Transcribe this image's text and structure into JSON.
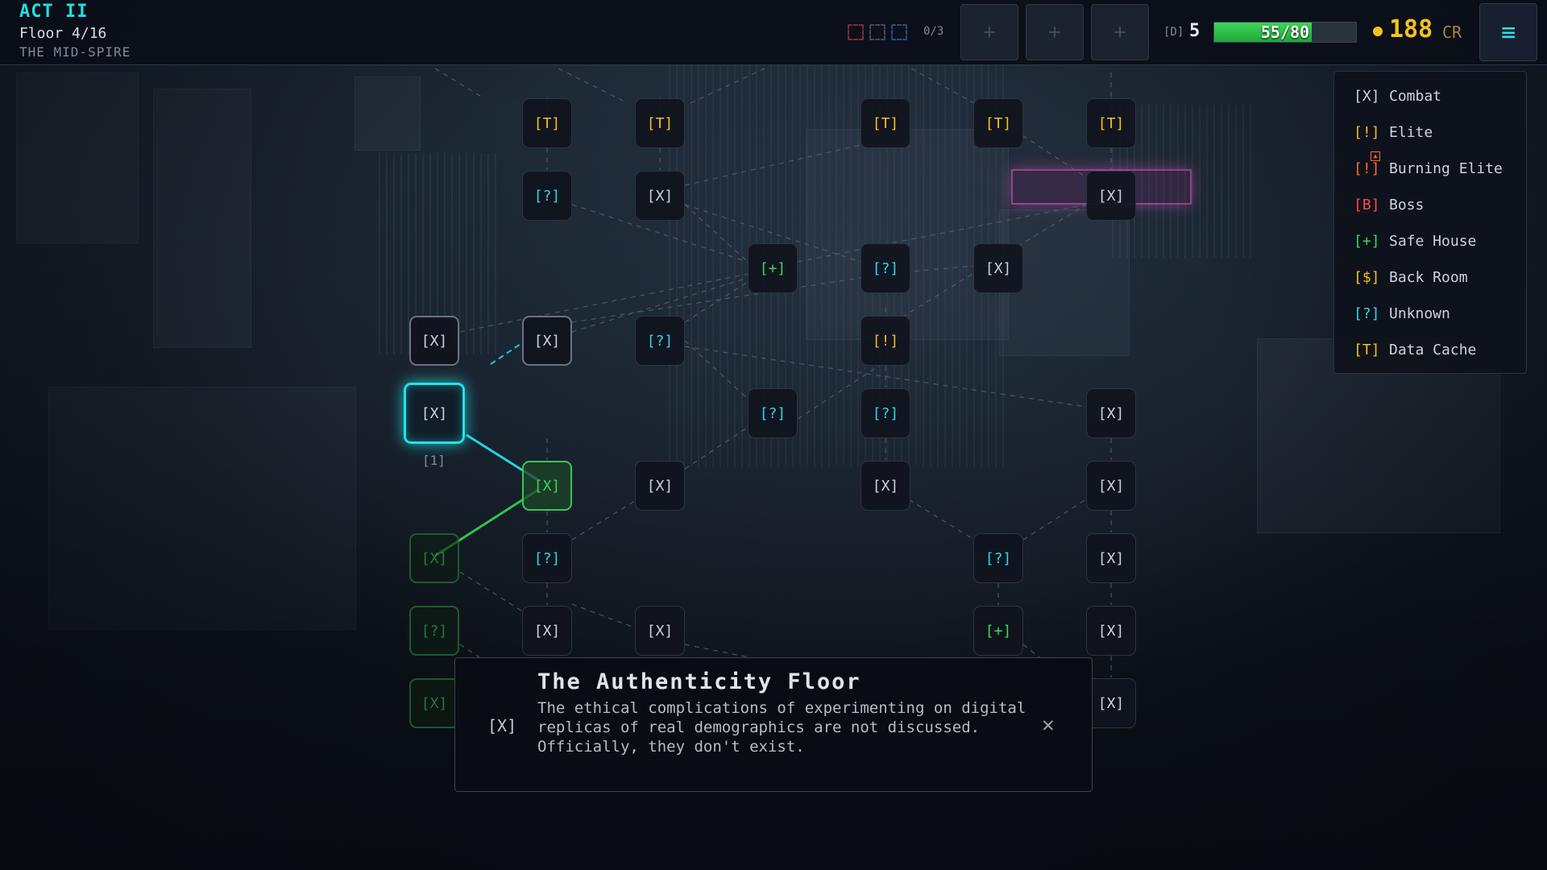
{
  "hud": {
    "act": "ACT II",
    "floor": "Floor 4/16",
    "zone": "THE MID-SPIRE",
    "consumable_slots": {
      "used_label": "0/3",
      "slot_colors": [
        "#8a2a30",
        "#3a4a6a",
        "#2a4a80"
      ]
    },
    "item_buttons": [
      "+",
      "+",
      "+"
    ],
    "deck": {
      "tag": "[D]",
      "count": "5"
    },
    "hp": {
      "text": "55/80",
      "current": 55,
      "max": 80,
      "color": "#3ed65a"
    },
    "credits": {
      "value": "188",
      "unit": "CR",
      "color": "#f5c21b"
    },
    "menu_icon": "≡"
  },
  "legend": [
    {
      "symbol": "[X]",
      "label": "Combat",
      "color": "#cdd3db"
    },
    {
      "symbol": "[!]",
      "label": "Elite",
      "color": "#f5b82e"
    },
    {
      "symbol": "[!]",
      "label": "Burning Elite",
      "color": "#ff6a2b"
    },
    {
      "symbol": "[B]",
      "label": "Boss",
      "color": "#ff4a4a"
    },
    {
      "symbol": "[+]",
      "label": "Safe House",
      "color": "#3fd45a"
    },
    {
      "symbol": "[$]",
      "label": "Back Room",
      "color": "#f5c21b"
    },
    {
      "symbol": "[?]",
      "label": "Unknown",
      "color": "#2ed8e6"
    },
    {
      "symbol": "[T]",
      "label": "Data Cache",
      "color": "#f5c21b"
    }
  ],
  "map": {
    "current_node_index": "[1]",
    "nodes": [
      {
        "id": "t1",
        "label": "[T]",
        "state": "normal",
        "color": "#f5c21b"
      },
      {
        "id": "t2",
        "label": "[T]",
        "state": "normal",
        "color": "#f5c21b"
      },
      {
        "id": "t3",
        "label": "[T]",
        "state": "normal",
        "color": "#f5c21b"
      },
      {
        "id": "t4",
        "label": "[T]",
        "state": "normal",
        "color": "#f5c21b"
      },
      {
        "id": "t5",
        "label": "[T]",
        "state": "normal",
        "color": "#f5c21b"
      },
      {
        "id": "u1",
        "label": "[?]",
        "state": "normal",
        "color": "#2ed8e6"
      },
      {
        "id": "x1",
        "label": "[X]",
        "state": "normal",
        "color": "#cdd3db"
      },
      {
        "id": "x2",
        "label": "[X]",
        "state": "normal",
        "color": "#cdd3db"
      },
      {
        "id": "s1",
        "label": "[+]",
        "state": "normal",
        "color": "#3fd45a"
      },
      {
        "id": "u2",
        "label": "[?]",
        "state": "normal",
        "color": "#2ed8e6"
      },
      {
        "id": "x3",
        "label": "[X]",
        "state": "normal",
        "color": "#cdd3db"
      },
      {
        "id": "x4",
        "label": "[X]",
        "state": "reachable",
        "color": "#cdd3db"
      },
      {
        "id": "x5",
        "label": "[X]",
        "state": "reachable",
        "color": "#cdd3db"
      },
      {
        "id": "u3",
        "label": "[?]",
        "state": "normal",
        "color": "#2ed8e6"
      },
      {
        "id": "e1",
        "label": "[!]",
        "state": "normal",
        "color": "#f5b82e"
      },
      {
        "id": "cur",
        "label": "[X]",
        "state": "current",
        "color": "#cdd3db"
      },
      {
        "id": "u4",
        "label": "[?]",
        "state": "normal",
        "color": "#2ed8e6"
      },
      {
        "id": "u5",
        "label": "[?]",
        "state": "normal",
        "color": "#2ed8e6"
      },
      {
        "id": "x6",
        "label": "[X]",
        "state": "normal",
        "color": "#cdd3db"
      },
      {
        "id": "v1",
        "label": "[X]",
        "state": "visited-next",
        "color": "#3fd45a"
      },
      {
        "id": "x7",
        "label": "[X]",
        "state": "normal",
        "color": "#cdd3db"
      },
      {
        "id": "x8",
        "label": "[X]",
        "state": "normal",
        "color": "#cdd3db"
      },
      {
        "id": "x9",
        "label": "[X]",
        "state": "normal",
        "color": "#cdd3db"
      },
      {
        "id": "v2",
        "label": "[X]",
        "state": "visited",
        "color": "#2f8f44"
      },
      {
        "id": "u6",
        "label": "[?]",
        "state": "normal",
        "color": "#2ed8e6"
      },
      {
        "id": "u7",
        "label": "[?]",
        "state": "normal",
        "color": "#2ed8e6"
      },
      {
        "id": "x10",
        "label": "[X]",
        "state": "normal",
        "color": "#cdd3db"
      },
      {
        "id": "v3",
        "label": "[?]",
        "state": "visited",
        "color": "#2f8f44"
      },
      {
        "id": "x11",
        "label": "[X]",
        "state": "normal",
        "color": "#cdd3db"
      },
      {
        "id": "x12",
        "label": "[X]",
        "state": "normal",
        "color": "#cdd3db"
      },
      {
        "id": "s2",
        "label": "[+]",
        "state": "normal",
        "color": "#3fd45a"
      },
      {
        "id": "x13",
        "label": "[X]",
        "state": "normal",
        "color": "#cdd3db"
      },
      {
        "id": "v4",
        "label": "[X]",
        "state": "visited",
        "color": "#2f8f44"
      },
      {
        "id": "x14",
        "label": "[X]",
        "state": "normal",
        "color": "#cdd3db"
      }
    ]
  },
  "tooltip": {
    "icon": "[X]",
    "title": "The Authenticity Floor",
    "body": "The ethical complications of experimenting on digital replicas of real demographics are not discussed. Officially, they don't exist.",
    "close_icon": "✕"
  }
}
